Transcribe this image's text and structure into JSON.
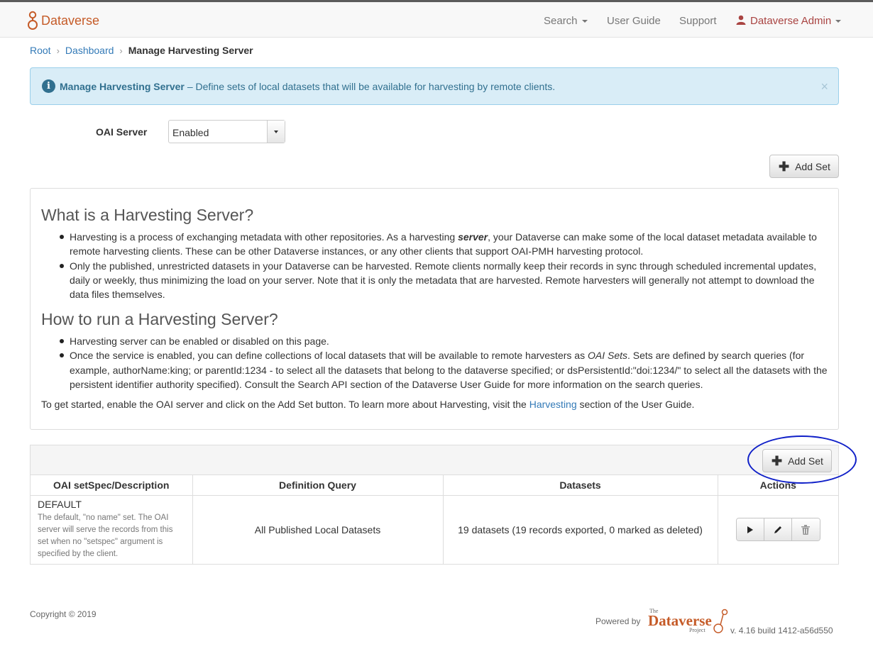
{
  "navbar": {
    "brand": "Dataverse",
    "search": "Search",
    "user_guide": "User Guide",
    "support": "Support",
    "user": "Dataverse Admin"
  },
  "breadcrumb": {
    "root": "Root",
    "dashboard": "Dashboard",
    "current": "Manage Harvesting Server"
  },
  "alert": {
    "title": "Manage Harvesting Server",
    "text": "– Define sets of local datasets that will be available for harvesting by remote clients.",
    "close": "×"
  },
  "oai_server": {
    "label": "OAI Server",
    "value": "Enabled"
  },
  "add_set_label": "Add Set",
  "info": {
    "heading1": "What is a Harvesting Server?",
    "b1_pre": "Harvesting is a process of exchanging metadata with other repositories. As a harvesting ",
    "b1_em": "server",
    "b1_post": ", your Dataverse can make some of the local dataset metadata available to remote harvesting clients. These can be other Dataverse instances, or any other clients that support OAI-PMH harvesting protocol.",
    "b2": "Only the published, unrestricted datasets in your Dataverse can be harvested. Remote clients normally keep their records in sync through scheduled incremental updates, daily or weekly, thus minimizing the load on your server. Note that it is only the metadata that are harvested. Remote harvesters will generally not attempt to download the data files themselves.",
    "heading2": "How to run a Harvesting Server?",
    "b3": "Harvesting server can be enabled or disabled on this page.",
    "b4_pre": "Once the service is enabled, you can define collections of local datasets that will be available to remote harvesters as ",
    "b4_em": "OAI Sets",
    "b4_post": ". Sets are defined by search queries (for example, authorName:king; or parentId:1234 - to select all the datasets that belong to the dataverse specified; or dsPersistentId:\"doi:1234/\" to select all the datasets with the persistent identifier authority specified). Consult the Search API section of the Dataverse User Guide for more information on the search queries.",
    "footer_pre": "To get started, enable the OAI server and click on the Add Set button. To learn more about Harvesting, visit the ",
    "footer_link": "Harvesting",
    "footer_post": " section of the User Guide."
  },
  "table": {
    "columns": [
      "OAI setSpec/Description",
      "Definition Query",
      "Datasets",
      "Actions"
    ],
    "rows": [
      {
        "name": "DEFAULT",
        "description": "The default, \"no name\" set. The OAI server will serve the records from this set when no \"setspec\" argument is specified by the client.",
        "query": "All Published Local Datasets",
        "datasets": "19 datasets (19 records exported, 0 marked as deleted)"
      }
    ]
  },
  "footer": {
    "copyright": "Copyright © 2019",
    "powered_by": "Powered by",
    "logo_the": "The",
    "logo_name": "Dataverse",
    "logo_project": "Project",
    "version": "v. 4.16 build 1412-a56d550"
  },
  "colors": {
    "brand": "#c55b28",
    "link": "#337ab7",
    "alert_bg": "#d9edf7",
    "alert_text": "#31708f",
    "annotation": "#1020c8"
  },
  "icons": [
    "dataverse-logo-icon",
    "user-icon",
    "info-icon",
    "plus-icon",
    "play-icon",
    "pencil-icon",
    "trash-icon"
  ]
}
